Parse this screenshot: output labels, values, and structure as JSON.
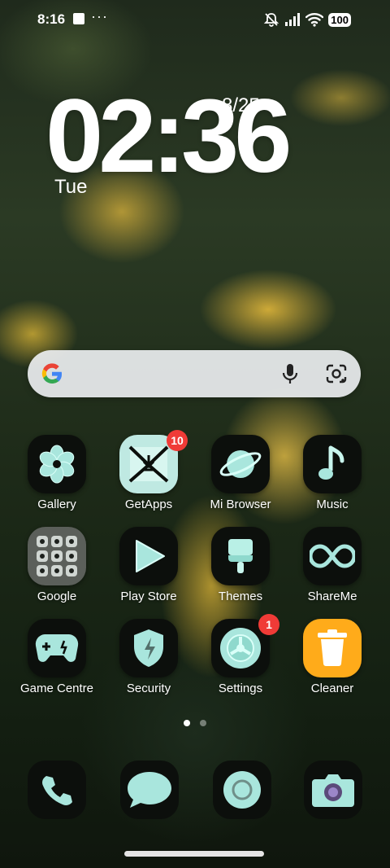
{
  "status_bar": {
    "time": "8:16",
    "more": "···",
    "battery": "100"
  },
  "clock": {
    "time_digits": "02:36",
    "date": "8/25",
    "day": "Tue"
  },
  "search": {
    "provider": "Google"
  },
  "apps": [
    {
      "label": "Gallery",
      "icon": "gallery-icon"
    },
    {
      "label": "GetApps",
      "icon": "getapps-icon",
      "badge": "10"
    },
    {
      "label": "Mi Browser",
      "icon": "browser-icon"
    },
    {
      "label": "Music",
      "icon": "music-icon"
    },
    {
      "label": "Google",
      "icon": "google-folder-icon"
    },
    {
      "label": "Play Store",
      "icon": "play-store-icon"
    },
    {
      "label": "Themes",
      "icon": "themes-icon"
    },
    {
      "label": "ShareMe",
      "icon": "shareme-icon"
    },
    {
      "label": "Game Centre",
      "icon": "game-centre-icon"
    },
    {
      "label": "Security",
      "icon": "security-icon"
    },
    {
      "label": "Settings",
      "icon": "settings-icon",
      "badge": "1"
    },
    {
      "label": "Cleaner",
      "icon": "cleaner-icon"
    }
  ],
  "dock": [
    {
      "icon": "phone-icon"
    },
    {
      "icon": "messages-icon"
    },
    {
      "icon": "browser-circle-icon"
    },
    {
      "icon": "camera-icon"
    }
  ],
  "page_indicator": {
    "pages": 2,
    "current": 1
  },
  "colors": {
    "icon_glow": "#b9f0e6",
    "badge": "#f03b37",
    "cleaner_bg": "#ffab1a",
    "search_bg": "#ebeef0"
  }
}
